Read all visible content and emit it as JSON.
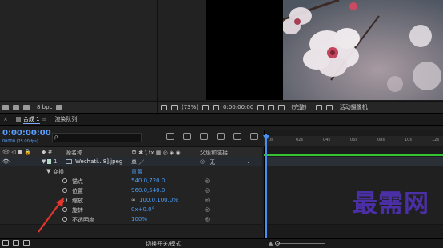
{
  "project_panel": {
    "bpc_label": "8 bpc"
  },
  "viewer": {
    "zoom": "(73%)",
    "timecode": "0:00:00:00",
    "resolution": "(完整)",
    "camera": "活动摄像机"
  },
  "tabs": [
    {
      "label": "合成 1",
      "active": true
    },
    {
      "label": "渲染队列",
      "active": false
    }
  ],
  "timeline": {
    "timecode": "0:00:00:00",
    "fps": "00000 (25.00 fps)",
    "search_placeholder": "⍴.",
    "columns": {
      "source_name": "源名称",
      "parent": "父级和链接"
    },
    "layer": {
      "index": "1",
      "name": "Wechati...8].jpeg",
      "parent": "无"
    },
    "transform": {
      "label": "变换",
      "reset": "重置",
      "properties": [
        {
          "name": "锚点",
          "value": "540.0,720.0"
        },
        {
          "name": "位置",
          "value": "960.0,540.0"
        },
        {
          "name": "缩放",
          "value": "100.0,100.0%"
        },
        {
          "name": "旋转",
          "value": "0x+0.0°"
        },
        {
          "name": "不透明度",
          "value": "100%"
        }
      ]
    },
    "ruler_ticks": [
      "0s",
      "02s",
      "04s",
      "06s",
      "08s",
      "10s",
      "12s"
    ],
    "footer_label": "切换开关/模式"
  },
  "watermark": "最需网",
  "colors": {
    "accent_blue": "#4a9bf2",
    "work_area_green": "#34c234",
    "arrow_red": "#e0362b",
    "watermark_purple": "#4b2fa6"
  }
}
